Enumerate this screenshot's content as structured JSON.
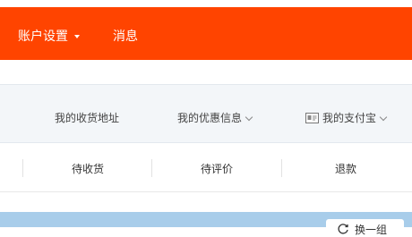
{
  "header": {
    "account_settings_label": "账户设置",
    "messages_label": "消息",
    "background_color": "#ff4400"
  },
  "sub_nav": {
    "items": [
      {
        "label": "我的收货地址",
        "icon": ""
      },
      {
        "label": "我的优惠信息",
        "icon": "chevron-down-icon"
      },
      {
        "label": "我的支付宝",
        "icon": "card-icon"
      }
    ]
  },
  "status_tabs": [
    {
      "label": "待收货"
    },
    {
      "label": "待评价"
    },
    {
      "label": "退款"
    }
  ],
  "bottom": {
    "chip_text": "换一组",
    "bar_color": "#a8cdea"
  }
}
